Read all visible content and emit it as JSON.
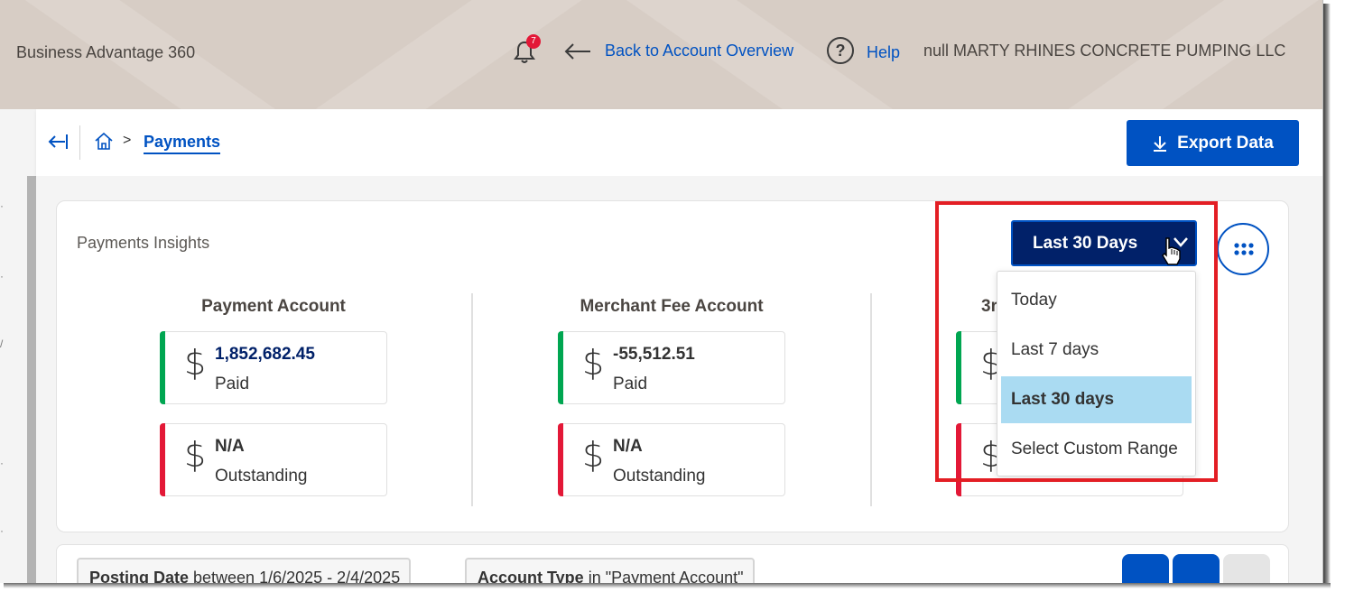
{
  "header": {
    "app_title": "Business Advantage 360",
    "notification_count": "7",
    "back_link": "Back to Account Overview",
    "help_label": "Help",
    "company_name": "null MARTY RHINES CONCRETE PUMPING LLC"
  },
  "breadcrumb": {
    "current": "Payments"
  },
  "toolbar": {
    "export_label": "Export Data"
  },
  "insights": {
    "title": "Payments Insights",
    "range_selected": "Last 30 Days",
    "columns": [
      {
        "title": "Payment Account",
        "paid_amount": "1,852,682.45",
        "paid_label": "Paid",
        "outstanding_amount": "N/A",
        "outstanding_label": "Outstanding"
      },
      {
        "title": "Merchant Fee Account",
        "paid_amount": "-55,512.51",
        "paid_label": "Paid",
        "outstanding_amount": "N/A",
        "outstanding_label": "Outstanding"
      },
      {
        "title": "3r",
        "paid_amount": "",
        "paid_label": "",
        "outstanding_amount": "",
        "outstanding_label": ""
      }
    ],
    "currency_symbol": "$"
  },
  "range_dropdown": {
    "options": [
      "Today",
      "Last 7 days",
      "Last 30 days",
      "Select Custom Range"
    ],
    "selected_index": 2
  },
  "filters": {
    "chips": [
      {
        "field": "Posting Date",
        "text": " between 1/6/2025 - 2/4/2025"
      },
      {
        "field": "Account Type",
        "text": " in \"Payment Account\""
      }
    ]
  },
  "colors": {
    "brand_blue": "#0052c2",
    "navy": "#012169",
    "paid_green": "#00a651",
    "outstanding_red": "#e31837",
    "selected_option": "#aadbf2",
    "highlight_box": "#e31e24"
  },
  "icons": [
    "bell-icon",
    "back-arrow-icon",
    "help-icon",
    "collapse-sidebar-icon",
    "home-icon",
    "download-icon",
    "chevron-down-icon",
    "grid-menu-icon",
    "pointer-cursor-icon"
  ]
}
